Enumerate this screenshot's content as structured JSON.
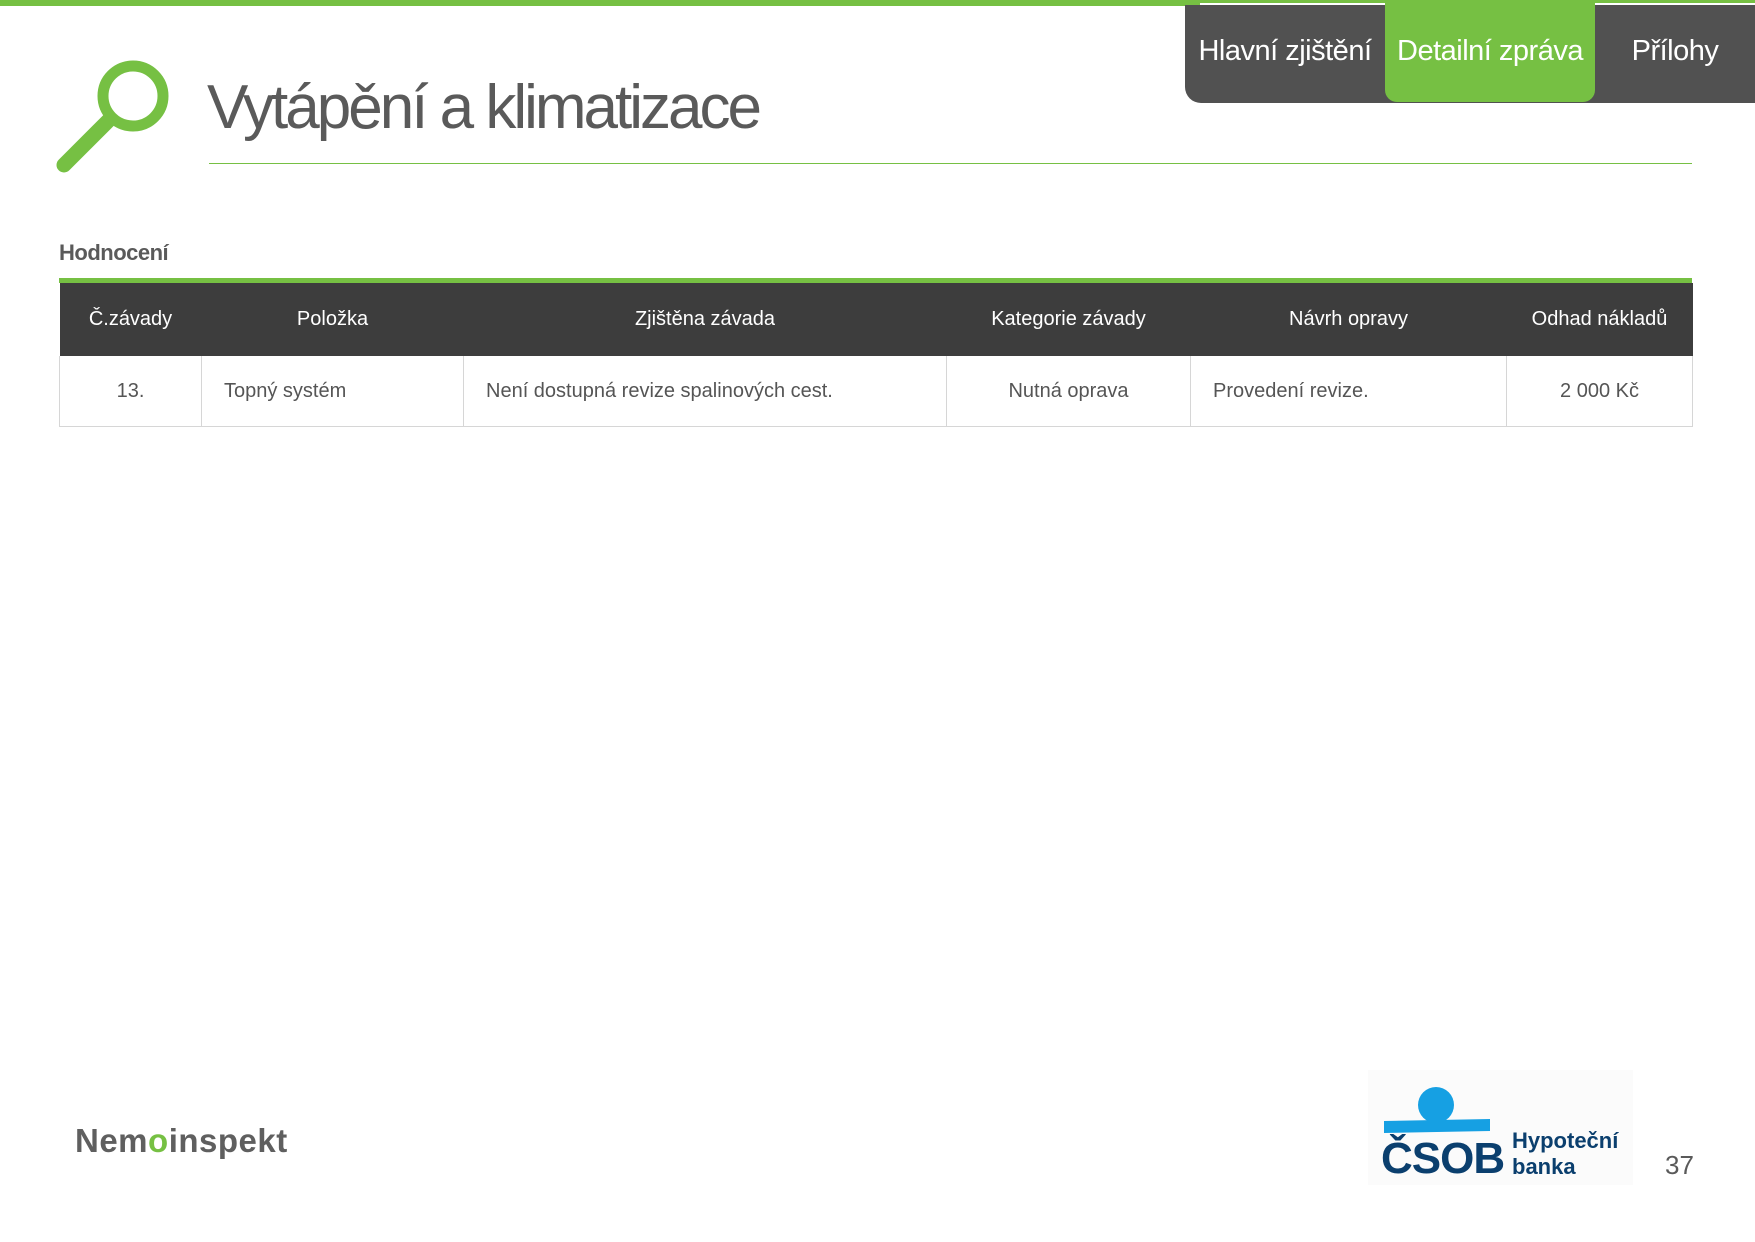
{
  "nav": {
    "tabs": [
      {
        "label": "Hlavní zjištění"
      },
      {
        "label": "Detailní zpráva",
        "active": true
      },
      {
        "label": "Přílohy"
      }
    ]
  },
  "header": {
    "title": "Vytápění a klimatizace"
  },
  "section": {
    "label": "Hodnocení"
  },
  "table": {
    "columns": [
      "Č.závady",
      "Položka",
      "Zjištěna závada",
      "Kategorie závady",
      "Návrh opravy",
      "Odhad nákladů"
    ],
    "rows": [
      {
        "number": "13.",
        "item": "Topný systém",
        "defect": "Není dostupná revize spalinových cest.",
        "category": "Nutná oprava",
        "repair": "Provedení revize.",
        "cost": "2 000 Kč"
      }
    ]
  },
  "footer": {
    "left_logo_prefix": "Nem",
    "left_logo_o": "o",
    "left_logo_suffix": "inspekt",
    "right_logo_main": "ČSOB",
    "right_logo_sub_line1": "Hypoteční",
    "right_logo_sub_line2": "banka",
    "page_number": "37"
  },
  "colors": {
    "accent_green": "#76c043",
    "dark_header": "#3d3d3d",
    "tab_bar": "#515151",
    "csob_blue": "#0b3f6e",
    "csob_light_blue": "#16a0e3"
  }
}
